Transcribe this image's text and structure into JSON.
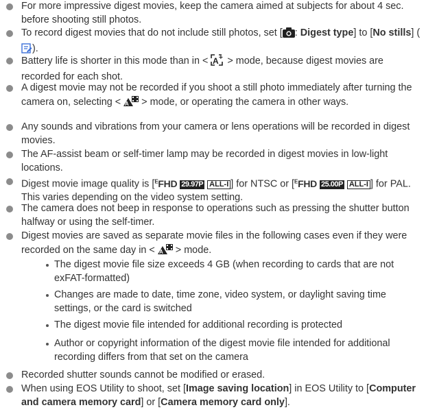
{
  "notes": [
    {
      "text": "For more impressive digest movies, keep the camera aimed at subjects for about 4 sec. before shooting still photos."
    },
    {
      "pre": "To record digest movies that do not include still photos, set [",
      "sep": ": ",
      "bold1": "Digest type",
      "mid": "] to [",
      "bold2": "No stills",
      "post": "] (",
      "post2": ")."
    },
    {
      "pre": "Battery life is shorter in this mode than in < ",
      "post": " > mode, because digest movies are recorded for each shot."
    },
    {
      "pre": "A digest movie may not be recorded if you shoot a still photo immediately after turning the camera on, selecting < ",
      "post": " > mode, or operating the camera in other ways."
    },
    {
      "text": "Any sounds and vibrations from your camera or lens operations will be recorded in digest movies."
    },
    {
      "text": "The AF-assist beam or self-timer lamp may be recorded in digest movies in low-light locations."
    },
    {
      "pre": "Digest movie image quality is [",
      "fhd": "FHD",
      "rate_ntsc": "29.97P",
      "comp": "ALL-I",
      "mid": "] for NTSC or [",
      "rate_pal": "25.00P",
      "post": "] for PAL. This varies depending on the video system setting."
    },
    {
      "text": "The camera does not beep in response to operations such as pressing the shutter button halfway or using the self-timer."
    },
    {
      "pre": "Digest movies are saved as separate movie files in the following cases even if they were recorded on the same day in < ",
      "post": " > mode."
    }
  ],
  "subnotes": [
    "The digest movie file size exceeds 4 GB (when recording to cards that are not exFAT-formatted)",
    "Changes are made to date, time zone, video system, or daylight saving time settings, or the card is switched",
    "The digest movie file intended for additional recording is protected",
    "Author or copyright information of the digest movie file intended for additional recording differs from that set on the camera"
  ],
  "tail_notes": [
    {
      "text": "Recorded shutter sounds cannot be modified or erased."
    },
    {
      "pre": "When using EOS Utility to shoot, set [",
      "bold1": "Image saving location",
      "mid": "] in EOS Utility to [",
      "bold2": "Computer and camera memory card",
      "mid2": "] or [",
      "bold3": "Camera memory card only",
      "post": "]."
    }
  ]
}
